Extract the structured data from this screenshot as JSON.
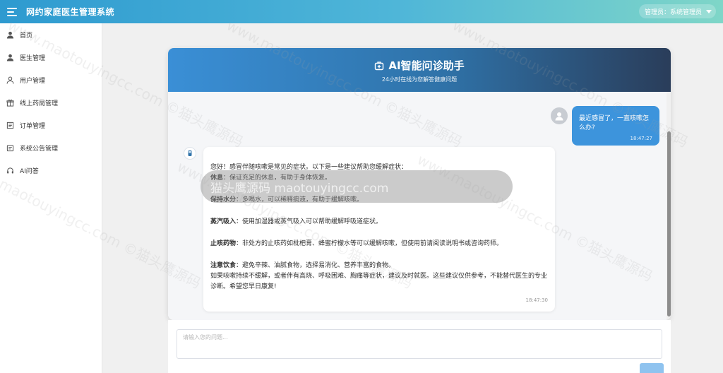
{
  "app": {
    "title": "网约家庭医生管理系统"
  },
  "user_menu": {
    "label": "管理员：系统管理员"
  },
  "sidebar": {
    "items": [
      {
        "label": "首页",
        "icon": "user-icon"
      },
      {
        "label": "医生管理",
        "icon": "user-icon"
      },
      {
        "label": "用户管理",
        "icon": "user-outline-icon"
      },
      {
        "label": "线上药局管理",
        "icon": "gift-icon"
      },
      {
        "label": "订单管理",
        "icon": "list-icon"
      },
      {
        "label": "系统公告管理",
        "icon": "notice-icon"
      },
      {
        "label": "AI问答",
        "icon": "headset-icon"
      }
    ]
  },
  "chat": {
    "title": "AI智能问诊助手",
    "subtitle": "24小时在线为您解答健康问题",
    "user_message": {
      "text": "最近感冒了，一直咳嗽怎么办?",
      "time": "18:47:27"
    },
    "bot_message": {
      "intro": "您好！感冒伴随咳嗽是常见的症状。以下是一些建议帮助您缓解症状：",
      "tips": [
        {
          "title": "休息",
          "body": "：保证充足的休息，有助于身体恢复。"
        },
        {
          "title": "保持水分",
          "body": "：多喝水，可以稀释痰液，有助于缓解咳嗽。"
        },
        {
          "title": "蒸汽吸入",
          "body": "：使用加湿器或蒸气吸入可以帮助缓解呼吸道症状。"
        },
        {
          "title": "止咳药物",
          "body": "：非处方的止咳药如枇杷膏、蜂蜜柠檬水等可以缓解咳嗽，但使用前请阅读说明书或咨询药师。"
        },
        {
          "title": "注意饮食",
          "body": "：避免辛辣、油腻食物，选择易消化、营养丰富的食物。"
        }
      ],
      "closing": "如果咳嗽持续不缓解，或者伴有高烧、呼吸困难、胸痛等症状，建议及时就医。这些建议仅供参考，不能替代医生的专业诊断。希望您早日康复!",
      "time": "18:47:30"
    }
  },
  "input": {
    "placeholder": "请输入您的问题..."
  },
  "overlay": {
    "text": "猫头鹰源码 maotouyingcc.com"
  },
  "watermark": {
    "text": "www.maotouyingcc.com ©猫头鹰源码"
  },
  "colors": {
    "accent": "#3d94dc",
    "header_start": "#2e9ad0",
    "header_end": "#7fd6c8"
  }
}
